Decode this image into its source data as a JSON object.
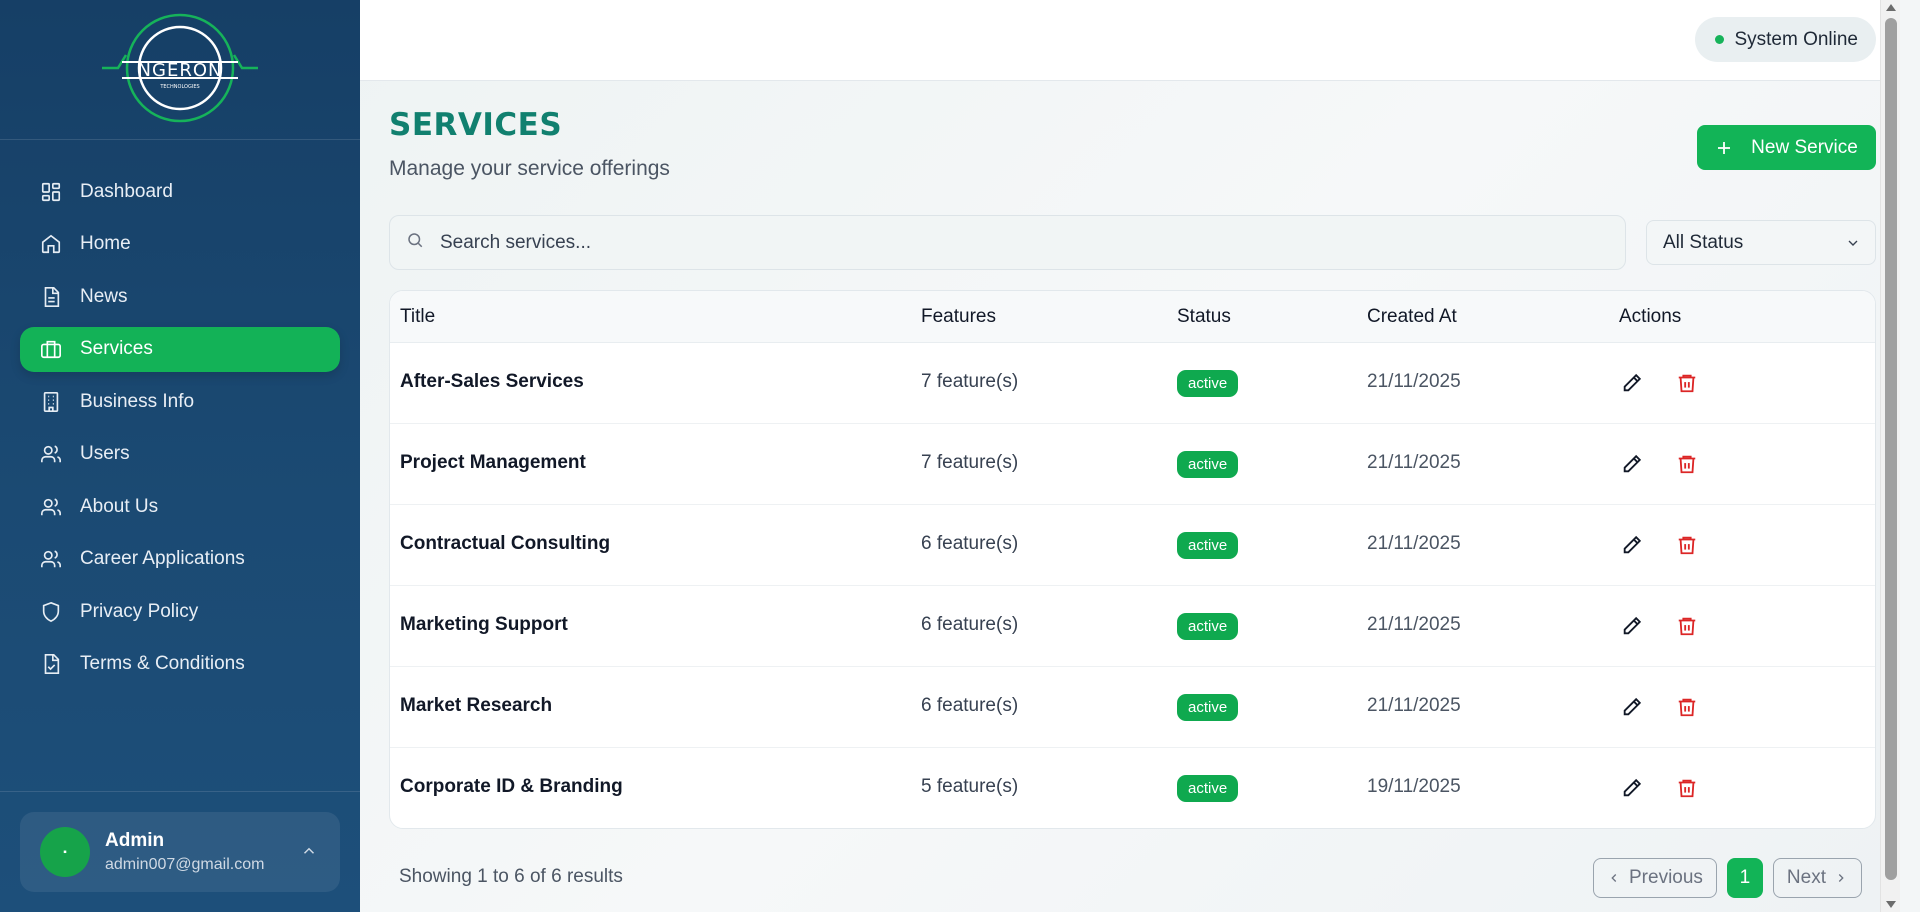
{
  "brand": {
    "logo_text": "NGERON",
    "logo_sub": "TECHNOLOGIES",
    "logo_green": "#16b35a"
  },
  "sidebar": {
    "items": [
      {
        "label": "Dashboard",
        "icon": "dashboard-icon"
      },
      {
        "label": "Home",
        "icon": "home-icon"
      },
      {
        "label": "News",
        "icon": "news-icon"
      },
      {
        "label": "Services",
        "icon": "briefcase-icon",
        "active": true
      },
      {
        "label": "Business Info",
        "icon": "building-icon"
      },
      {
        "label": "Users",
        "icon": "users-icon"
      },
      {
        "label": "About Us",
        "icon": "users-icon"
      },
      {
        "label": "Career Applications",
        "icon": "users-icon"
      },
      {
        "label": "Privacy Policy",
        "icon": "shield-icon"
      },
      {
        "label": "Terms & Conditions",
        "icon": "document-check-icon"
      }
    ],
    "user": {
      "name": "Admin",
      "email": "admin007@gmail.com"
    }
  },
  "header": {
    "status": "System Online"
  },
  "page": {
    "title": "SERVICES",
    "subtitle": "Manage your service offerings",
    "new_button": "New Service"
  },
  "search": {
    "placeholder": "Search services...",
    "value": ""
  },
  "filter": {
    "selected": "All Status"
  },
  "table": {
    "columns": [
      "Title",
      "Features",
      "Status",
      "Created At",
      "Actions"
    ],
    "rows": [
      {
        "title": "After-Sales Services",
        "features": "7 feature(s)",
        "status": "active",
        "created": "21/11/2025"
      },
      {
        "title": "Project Management",
        "features": "7 feature(s)",
        "status": "active",
        "created": "21/11/2025"
      },
      {
        "title": "Contractual Consulting",
        "features": "6 feature(s)",
        "status": "active",
        "created": "21/11/2025"
      },
      {
        "title": "Marketing Support",
        "features": "6 feature(s)",
        "status": "active",
        "created": "21/11/2025"
      },
      {
        "title": "Market Research",
        "features": "6 feature(s)",
        "status": "active",
        "created": "21/11/2025"
      },
      {
        "title": "Corporate ID & Branding",
        "features": "5 feature(s)",
        "status": "active",
        "created": "19/11/2025"
      }
    ]
  },
  "pagination": {
    "summary": "Showing 1 to 6 of 6 results",
    "previous": "Previous",
    "current": "1",
    "next": "Next"
  },
  "colors": {
    "accent": "#12b457",
    "sidebar": "#1b4a73",
    "title": "#11806f",
    "delete": "#dc2626"
  }
}
